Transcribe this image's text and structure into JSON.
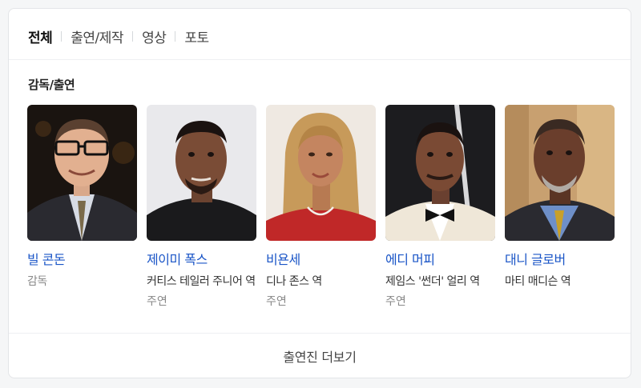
{
  "tabs": [
    {
      "label": "전체",
      "active": true
    },
    {
      "label": "출연/제작",
      "active": false
    },
    {
      "label": "영상",
      "active": false
    },
    {
      "label": "포토",
      "active": false
    }
  ],
  "section": {
    "title": "감독/출연"
  },
  "people": [
    {
      "name": "빌 콘돈",
      "role": "감독",
      "type": ""
    },
    {
      "name": "제이미 폭스",
      "role": "커티스 테일러 주니어 역",
      "type": "주연"
    },
    {
      "name": "비욘세",
      "role": "디나 존스 역",
      "type": "주연"
    },
    {
      "name": "에디 머피",
      "role": "제임스 '썬더' 얼리 역",
      "type": "주연"
    },
    {
      "name": "대니 글로버",
      "role": "마티 매디슨 역",
      "type": ""
    }
  ],
  "more": {
    "label": "출연진 더보기"
  },
  "colors": {
    "link": "#1a55c7",
    "muted": "#888888",
    "text": "#333333"
  }
}
